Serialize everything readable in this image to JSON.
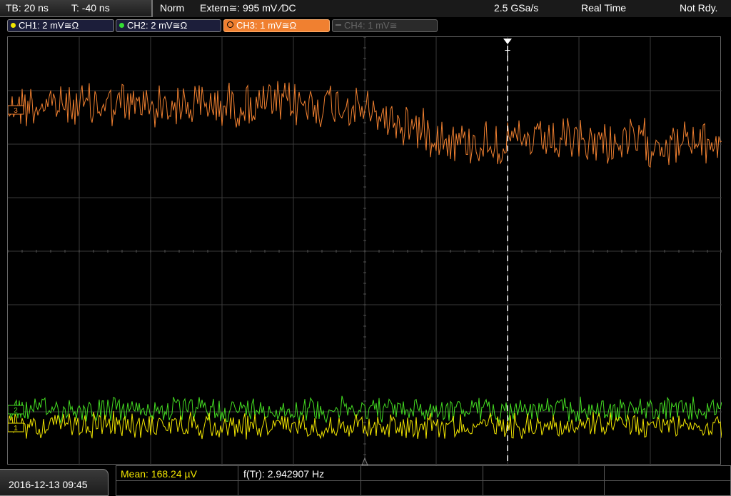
{
  "topbar": {
    "timebase": "TB: 20 ns",
    "trigger_time": "T: -40 ns",
    "trigger_mode": "Norm",
    "trigger_source": "Extern≅: 995 mV ∕DC",
    "sample_rate": "2.5 GSa/s",
    "acq_mode": "Real Time",
    "status": "Not Rdy."
  },
  "channels": [
    {
      "label": "CH1: 2 mV≅Ω",
      "color": "#f2e600",
      "active": true
    },
    {
      "label": "CH2: 2 mV≅Ω",
      "color": "#33dd33",
      "active": true
    },
    {
      "label": "CH3: 1 mV≅Ω",
      "color": "#f08030",
      "active": true,
      "selected": true
    },
    {
      "label": "CH4: 1 mV≅",
      "color": "#555555",
      "active": false
    }
  ],
  "markers": {
    "trigger": "T",
    "ch3": "3",
    "ch2": "2",
    "ch1": "1"
  },
  "traces": {
    "ch1_color": "#f2e600",
    "ch2_color": "#44dd22",
    "ch3_color": "#f08030"
  },
  "bottom": {
    "datetime": "2016-12-13 09:45",
    "mean_label": "Mean: 168.24 µV",
    "freq_label": "f(Tr): 2.942907 Hz"
  }
}
